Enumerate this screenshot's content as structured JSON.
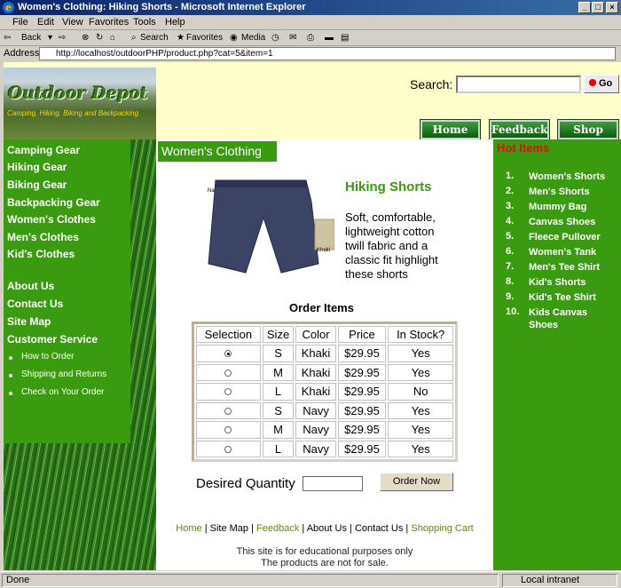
{
  "window": {
    "title": "Women's Clothing: Hiking Shorts - Microsoft Internet Explorer"
  },
  "menu": [
    "File",
    "Edit",
    "View",
    "Favorites",
    "Tools",
    "Help"
  ],
  "toolbar": {
    "back": "Back",
    "search": "Search",
    "favorites": "Favorites",
    "media": "Media"
  },
  "address": {
    "label": "Address",
    "url": "http://localhost/outdoorPHP/product.php?cat=5&item=1"
  },
  "logo": {
    "title": "Outdoor Depot",
    "tagline": "Camping, Hiking, Biking and Backpacking"
  },
  "search": {
    "label": "Search:",
    "go": "Go"
  },
  "nav": {
    "home": "Home",
    "feedback": "Feedback",
    "cart": "Shop Cart"
  },
  "sidebar": {
    "categories": [
      "Camping Gear",
      "Hiking Gear",
      "Biking Gear",
      "Backpacking Gear",
      "Women's Clothes",
      "Men's Clothes",
      "Kid's Clothes"
    ],
    "links": [
      "About Us",
      "Contact Us",
      "Site Map",
      "Customer Service"
    ],
    "service": [
      "How to Order",
      "Shipping and Returns",
      "Check on Your Order"
    ]
  },
  "main": {
    "category": "Women's Clothing",
    "product_name": "Hiking Shorts",
    "product_desc": "Soft, comfortable, lightweight cotton twill fabric and a classic fit highlight these shorts",
    "swatch_navy": "Navy",
    "swatch_khaki": "Khaki",
    "order_title": "Order Items",
    "columns": [
      "Selection",
      "Size",
      "Color",
      "Price",
      "In Stock?"
    ],
    "rows": [
      {
        "selected": true,
        "size": "S",
        "color": "Khaki",
        "price": "$29.95",
        "stock": "Yes"
      },
      {
        "selected": false,
        "size": "M",
        "color": "Khaki",
        "price": "$29.95",
        "stock": "Yes"
      },
      {
        "selected": false,
        "size": "L",
        "color": "Khaki",
        "price": "$29.95",
        "stock": "No"
      },
      {
        "selected": false,
        "size": "S",
        "color": "Navy",
        "price": "$29.95",
        "stock": "Yes"
      },
      {
        "selected": false,
        "size": "M",
        "color": "Navy",
        "price": "$29.95",
        "stock": "Yes"
      },
      {
        "selected": false,
        "size": "L",
        "color": "Navy",
        "price": "$29.95",
        "stock": "Yes"
      }
    ],
    "qty_label": "Desired Quantity",
    "order_button": "Order Now"
  },
  "footer": {
    "links": [
      "Home",
      "Site Map",
      "Feedback",
      "About Us",
      "Contact Us",
      "Shopping Cart"
    ],
    "note1": "This site is for educational purposes only",
    "note2": "The products are not for sale."
  },
  "hot": {
    "title": "Hot Items",
    "items": [
      "Women's Shorts",
      "Men's Shorts",
      "Mummy Bag",
      "Canvas Shoes",
      "Fleece Pullover",
      "Women's Tank",
      "Men's Tee Shirt",
      "Kid's Shorts",
      "Kid's Tee Shirt",
      "Kids Canvas Shoes"
    ]
  },
  "status": {
    "left": "Done",
    "zone": "Local intranet"
  },
  "colors": {
    "green": "#3a9a10",
    "banner": "#ffffcc",
    "hot": "#e01010"
  }
}
